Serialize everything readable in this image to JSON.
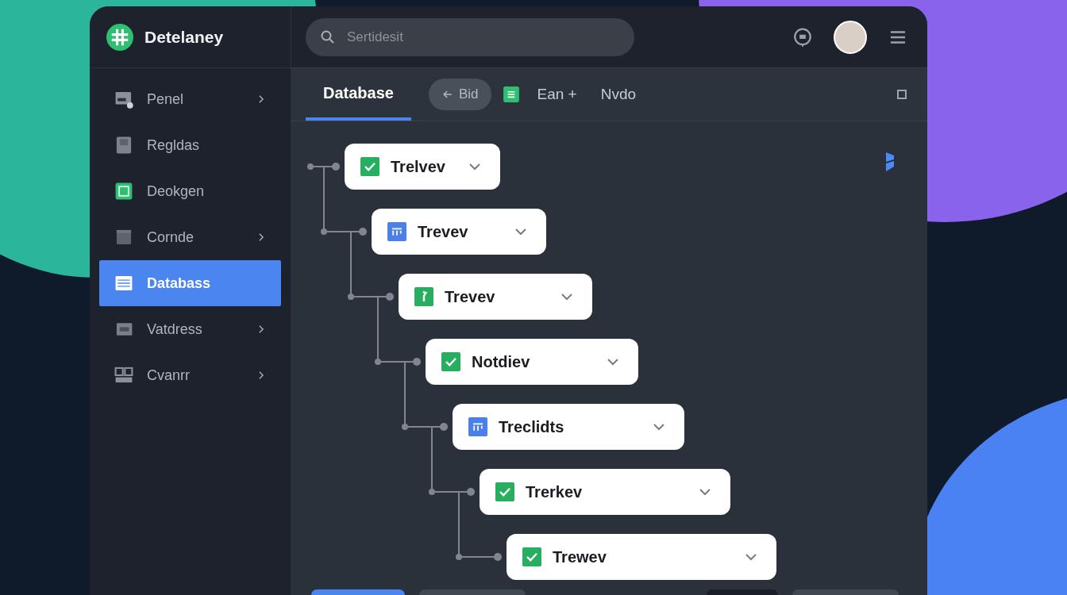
{
  "header": {
    "app_name": "Detelaney",
    "search": {
      "placeholder": "Sertidesit"
    }
  },
  "sidebar": {
    "items": [
      {
        "label": "Penel",
        "kind": "panel",
        "expandable": true,
        "selected": false
      },
      {
        "label": "Regldas",
        "kind": "disk",
        "expandable": false,
        "selected": false
      },
      {
        "label": "Deokgen",
        "kind": "square",
        "expandable": false,
        "selected": false
      },
      {
        "label": "Cornde",
        "kind": "folder",
        "expandable": true,
        "selected": false
      },
      {
        "label": "Databass",
        "kind": "list",
        "expandable": false,
        "selected": true
      },
      {
        "label": "Vatdress",
        "kind": "card",
        "expandable": true,
        "selected": false
      },
      {
        "label": "Cvanrr",
        "kind": "grid",
        "expandable": true,
        "selected": false
      }
    ]
  },
  "toolbar": {
    "tabs": [
      {
        "label": "Database",
        "selected": true
      }
    ],
    "back_button": "Bid",
    "actions": [
      "Ean +",
      "Nvdo"
    ]
  },
  "tree": [
    {
      "label": "Trelvev",
      "kind": "check",
      "children": [
        {
          "label": "Trevev",
          "kind": "card",
          "children": [
            {
              "label": "Trevev",
              "kind": "flag",
              "children": [
                {
                  "label": "Notdiev",
                  "kind": "check",
                  "children": [
                    {
                      "label": "Treclidts",
                      "kind": "card",
                      "children": [
                        {
                          "label": "Trerkev",
                          "kind": "check",
                          "children": [
                            {
                              "label": "Trewev",
                              "kind": "check"
                            }
                          ]
                        }
                      ]
                    }
                  ]
                }
              ]
            }
          ]
        }
      ]
    }
  ],
  "footer_buttons": [
    {
      "kind": "primary"
    },
    {
      "kind": "secondary"
    },
    {
      "kind": "dark"
    },
    {
      "kind": "secondary"
    }
  ]
}
